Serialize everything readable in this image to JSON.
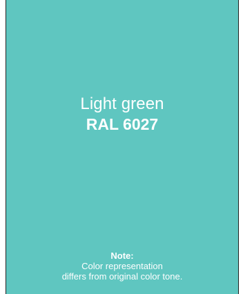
{
  "color": {
    "name_part1": "Light",
    "name_part2": "green",
    "code": "RAL 6027",
    "hex": "#5fc6c0"
  },
  "note": {
    "label": "Note:",
    "line1": "Color representation",
    "line2": "differs from original color tone."
  }
}
